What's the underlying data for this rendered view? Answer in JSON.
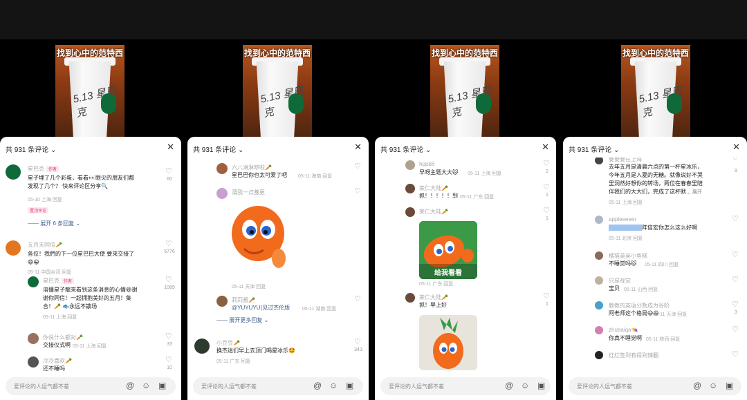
{
  "video_title": "找到心中的范特西",
  "cup_text": "5.13 星巴克",
  "header": "共 931 条评论",
  "input_placeholder": "爱评论的人运气都不差",
  "icons": [
    "close-icon",
    "heart-icon",
    "at-icon",
    "emoji-icon",
    "image-icon"
  ],
  "p1": {
    "c1": {
      "name": "星巴克",
      "tag": "作者",
      "text1": "星子埋了几个彩蛋，看看👀眼尖的朋友们都",
      "text2": "发现了几个？ 快来评论区分享🔍",
      "meta": "05-10 上海 回复",
      "likes": "60",
      "label": "置顶评论",
      "expand": "展开 6 条回复"
    },
    "c2": {
      "name": "五月天同信🥕",
      "text1": "各位！我們的下一位星巴巴大使 要來交接了",
      "text2": "😄😀",
      "meta": "05-11 中国台湾 回复",
      "likes": "5776"
    },
    "c3": {
      "name": "星巴克",
      "tag": "作者",
      "text1": "溶僵星子龍來看到这条消息的心情😆谢",
      "text2": "谢你同信！一起拥抱美好的五月！集",
      "text3": "合！🥕 🐟永远不散场",
      "meta": "05-11 上海 回复",
      "likes": "1089"
    },
    "c4": {
      "name": "你说什么都对🥕",
      "text": "交接仪式啊",
      "meta": "05-11 上海 回复",
      "likes": "33"
    },
    "c5": {
      "name": "冷冷喜欢🥕",
      "text": "还不睡吗",
      "likes": "10"
    }
  },
  "p2": {
    "c1": {
      "name": "六八淋淋哆啦🥕",
      "text": "星巴巴你也太可爱了吧",
      "meta": "05-11 海南 回复"
    },
    "c2": {
      "name": "蒲我一点蓋更"
    },
    "c3": {
      "meta": "05-11 天津 回复"
    },
    "c4": {
      "name": "莉莉酱🥕",
      "text": "@YUYUYU(见过杰伦版",
      "meta": "05-11 湖南 回复",
      "expand": "展开更多回复"
    },
    "c5": {
      "name": "小豆豆🥕",
      "text": "换杰迷们早上去顶门喝星冰乐🤩",
      "meta": "05-11 广东 回复",
      "likes": "343"
    }
  },
  "p3": {
    "c1": {
      "name": "hppb8",
      "text": "早呀主题大大🐱",
      "meta": "05-11 上海 回复",
      "likes": "2"
    },
    "c2": {
      "name": "莱仁大陆🥕",
      "text": "抓！！！！！到",
      "meta": "05-11 广东 回复",
      "likes": "1"
    },
    "c3": {
      "name": "莱仁大陆🥕",
      "likes": "1",
      "sticker": "给我看看"
    },
    "c4": {
      "meta": "05-11 广东 回复"
    },
    "c5": {
      "name": "莱仁大陆🥕",
      "text": "抓！早上好",
      "likes": "1"
    }
  },
  "p4": {
    "c0": {
      "likes": "9"
    },
    "c1": {
      "name": "要要要在上海",
      "text1": "去年五月是清晨六点的第一杯星冰乐，",
      "text2": "今年五月是入夏的无糖。就像说好不哭",
      "text3": "里洞然好想你的转场，两位在春春里陪",
      "text4": "伴我们的大大们，完成了这杯默...",
      "expand": "展开",
      "meta": "05-11 上海 回复"
    },
    "c2": {
      "name": "appleeeeer",
      "text": "阵信宏你怎么这么好啊",
      "meta": "05-11 北京 回复"
    },
    "c3": {
      "name": "橘猫英英小鱼糕",
      "text": "不睡觉吗🐱",
      "meta": "05-11 四川 回复"
    },
    "c4": {
      "name": "只是视觉",
      "text": "宝贝",
      "meta": "05-11 山西 回复"
    },
    "c5": {
      "name": "教教的英语分数成为谷阶",
      "text": "阿老师这个格局😃😃",
      "meta": "05-11 天津 回复",
      "likes": "3"
    },
    "c6": {
      "name": "zhubaiqa👒",
      "text": "你真不睡觉啊",
      "meta": "05-11 陕西 回复"
    },
    "c7": {
      "name": "红红签到有得到辣翻"
    }
  }
}
